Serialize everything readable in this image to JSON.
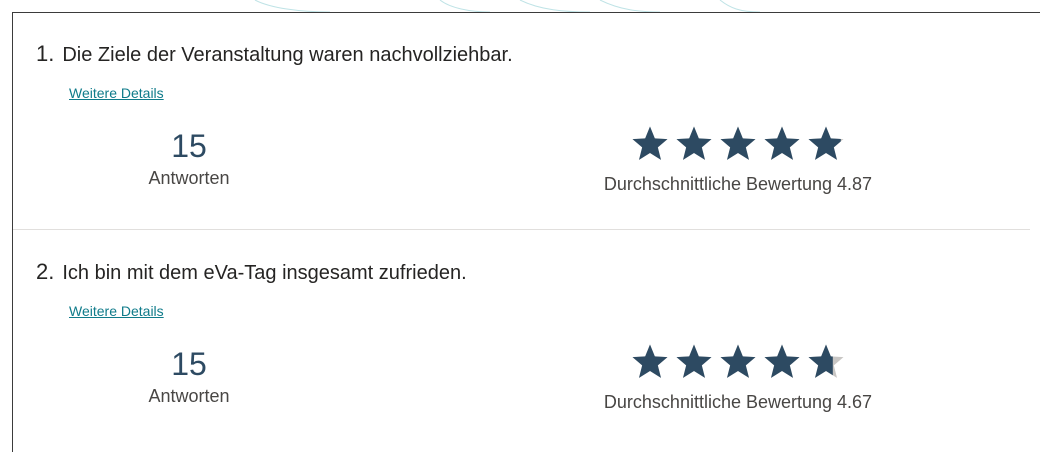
{
  "questions": [
    {
      "number": "1.",
      "text": "Die Ziele der Veranstaltung waren nachvollziehbar.",
      "details_link": "Weitere Details",
      "responses_count": "15",
      "responses_label": "Antworten",
      "average_label": "Durchschnittliche Bewertung 4.87",
      "average_rating": 4.87,
      "max_rating": 5
    },
    {
      "number": "2.",
      "text": "Ich bin mit dem eVa-Tag insgesamt zufrieden.",
      "details_link": "Weitere Details",
      "responses_count": "15",
      "responses_label": "Antworten",
      "average_label": "Durchschnittliche Bewertung 4.67",
      "average_rating": 4.67,
      "max_rating": 5
    }
  ],
  "colors": {
    "star_filled": "#2d4a62",
    "star_empty": "#c8c6c4",
    "link": "#0f7b8a",
    "divider": "#e1dfdd"
  }
}
